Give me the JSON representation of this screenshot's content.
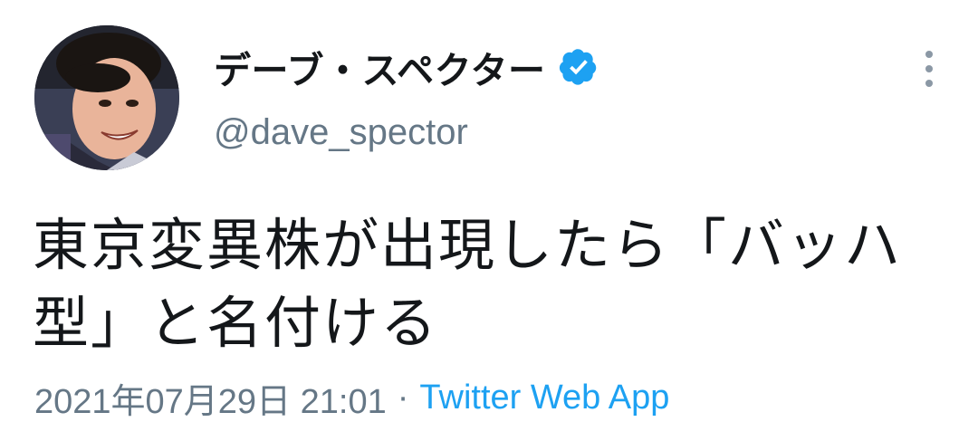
{
  "tweet": {
    "display_name": "デーブ・スペクター",
    "handle": "@dave_spector",
    "text": "東京変異株が出現したら「バッハ型」と名付ける",
    "timestamp": "2021年07月29日 21:01",
    "separator": "·",
    "source": "Twitter Web App",
    "verified_icon": "verified-badge-icon",
    "more_icon": "more-vertical-icon"
  },
  "colors": {
    "name": "#14171a",
    "secondary": "#657786",
    "accent": "#1da1f2"
  }
}
